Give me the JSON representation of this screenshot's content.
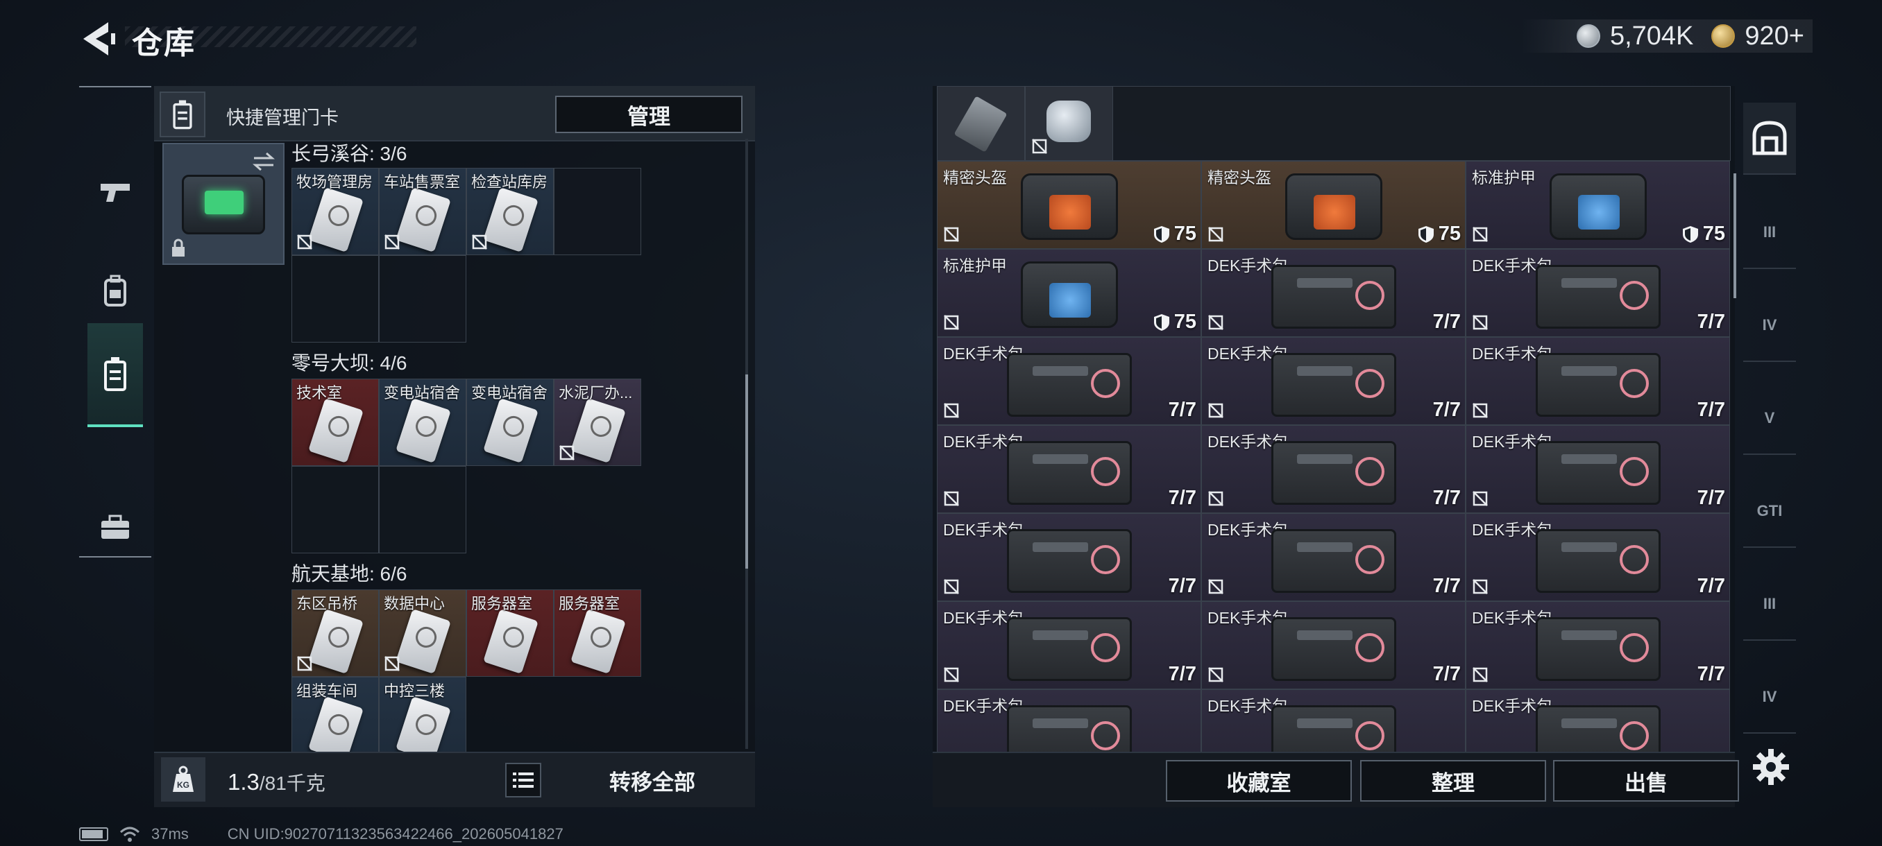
{
  "header": {
    "title": "仓库",
    "currency": [
      {
        "icon": "silver-coin-icon",
        "value": "5,704K"
      },
      {
        "icon": "gold-coin-icon",
        "value": "920+"
      }
    ]
  },
  "left_nav": {
    "items": [
      {
        "icon": "gun-icon",
        "active": false
      },
      {
        "icon": "backpack-icon",
        "active": false
      },
      {
        "icon": "keycard-case-icon",
        "active": true
      },
      {
        "icon": "briefcase-icon",
        "active": false
      }
    ]
  },
  "left_panel": {
    "quick_label": "快捷管理门卡",
    "manage_label": "管理",
    "sections": [
      {
        "title": "长弓溪谷: 3/6",
        "cells": [
          {
            "label": "牧场管理房",
            "bg": "blue",
            "nolink": true
          },
          {
            "label": "车站售票室",
            "bg": "blue",
            "nolink": true
          },
          {
            "label": "检查站库房",
            "bg": "blue",
            "nolink": true
          }
        ]
      },
      {
        "title": "零号大坝: 4/6",
        "cells": [
          {
            "label": "技术室",
            "bg": "red",
            "nolink": false
          },
          {
            "label": "变电站宿舍",
            "bg": "blue",
            "nolink": false
          },
          {
            "label": "变电站宿舍",
            "bg": "blue",
            "nolink": false
          },
          {
            "label": "水泥厂办...",
            "bg": "purple",
            "nolink": true
          }
        ]
      },
      {
        "title": "航天基地: 6/6",
        "cells": [
          {
            "label": "东区吊桥",
            "bg": "brown",
            "nolink": true
          },
          {
            "label": "数据中心",
            "bg": "brown",
            "nolink": true
          },
          {
            "label": "服务器室",
            "bg": "red",
            "nolink": false
          },
          {
            "label": "服务器室",
            "bg": "red",
            "nolink": false
          },
          {
            "label": "组装车间",
            "bg": "blue",
            "nolink": false
          },
          {
            "label": "中控三楼",
            "bg": "blue",
            "nolink": false
          }
        ]
      }
    ],
    "weight_value": "1.3",
    "weight_max": "/81千克",
    "transfer_all_label": "转移全部"
  },
  "status_bar": {
    "ping": "37ms",
    "uid": "CN UID:902707113235634224​66_202605041827"
  },
  "right_panel": {
    "rows": [
      [
        {
          "label": "",
          "art": "blade",
          "val": "",
          "nolink": false,
          "bg": "purple",
          "span": 1
        },
        {
          "label": "",
          "art": "can",
          "val": "",
          "nolink": true,
          "bg": "purple",
          "span": 1
        }
      ],
      [
        {
          "label": "精密头盔",
          "art": "bag-orange",
          "val": "75",
          "shield": true,
          "nolink": true,
          "bg": "brown"
        },
        {
          "label": "精密头盔",
          "art": "bag-orange",
          "val": "75",
          "shield": true,
          "nolink": true,
          "bg": "brown"
        },
        {
          "label": "标准护甲",
          "art": "bag-blue",
          "val": "75",
          "shield": true,
          "nolink": true,
          "bg": "purple"
        }
      ],
      [
        {
          "label": "标准护甲",
          "art": "bag-blue",
          "val": "75",
          "shield": true,
          "nolink": true,
          "bg": "purple"
        },
        {
          "label": "DEK手术包",
          "art": "kit",
          "val": "7/7",
          "nolink": true,
          "bg": "purple"
        },
        {
          "label": "DEK手术包",
          "art": "kit",
          "val": "7/7",
          "nolink": true,
          "bg": "purple"
        }
      ],
      [
        {
          "label": "DEK手术包",
          "art": "kit",
          "val": "7/7",
          "nolink": true,
          "bg": "purple"
        },
        {
          "label": "DEK手术包",
          "art": "kit",
          "val": "7/7",
          "nolink": true,
          "bg": "purple"
        },
        {
          "label": "DEK手术包",
          "art": "kit",
          "val": "7/7",
          "nolink": true,
          "bg": "purple"
        }
      ],
      [
        {
          "label": "DEK手术包",
          "art": "kit",
          "val": "7/7",
          "nolink": true,
          "bg": "purple"
        },
        {
          "label": "DEK手术包",
          "art": "kit",
          "val": "7/7",
          "nolink": true,
          "bg": "purple"
        },
        {
          "label": "DEK手术包",
          "art": "kit",
          "val": "7/7",
          "nolink": true,
          "bg": "purple"
        }
      ],
      [
        {
          "label": "DEK手术包",
          "art": "kit",
          "val": "7/7",
          "nolink": true,
          "bg": "purple"
        },
        {
          "label": "DEK手术包",
          "art": "kit",
          "val": "7/7",
          "nolink": true,
          "bg": "purple"
        },
        {
          "label": "DEK手术包",
          "art": "kit",
          "val": "7/7",
          "nolink": true,
          "bg": "purple"
        }
      ],
      [
        {
          "label": "DEK手术包",
          "art": "kit",
          "val": "7/7",
          "nolink": true,
          "bg": "purple"
        },
        {
          "label": "DEK手术包",
          "art": "kit",
          "val": "7/7",
          "nolink": true,
          "bg": "purple"
        },
        {
          "label": "DEK手术包",
          "art": "kit",
          "val": "7/7",
          "nolink": true,
          "bg": "purple"
        }
      ],
      [
        {
          "label": "DEK手术包",
          "art": "kit",
          "val": "",
          "nolink": false,
          "bg": "purple"
        },
        {
          "label": "DEK手术包",
          "art": "kit",
          "val": "",
          "nolink": false,
          "bg": "purple"
        },
        {
          "label": "DEK手术包",
          "art": "kit",
          "val": "",
          "nolink": false,
          "bg": "purple"
        }
      ]
    ],
    "buttons": [
      "收藏室",
      "整理",
      "出售"
    ]
  },
  "right_nav": {
    "items": [
      {
        "icon": "vault-icon",
        "text": "",
        "active": true
      },
      {
        "icon": "tier-3-storage-icon",
        "text": "III"
      },
      {
        "icon": "tier-4-storage-icon",
        "text": "IV"
      },
      {
        "icon": "tier-5-storage-icon",
        "text": "V"
      },
      {
        "icon": "gti-storage-icon",
        "text": "GTI"
      },
      {
        "icon": "tier-3-ammo-icon",
        "text": "III"
      },
      {
        "icon": "tier-4-ammo-icon",
        "text": "IV"
      }
    ]
  }
}
